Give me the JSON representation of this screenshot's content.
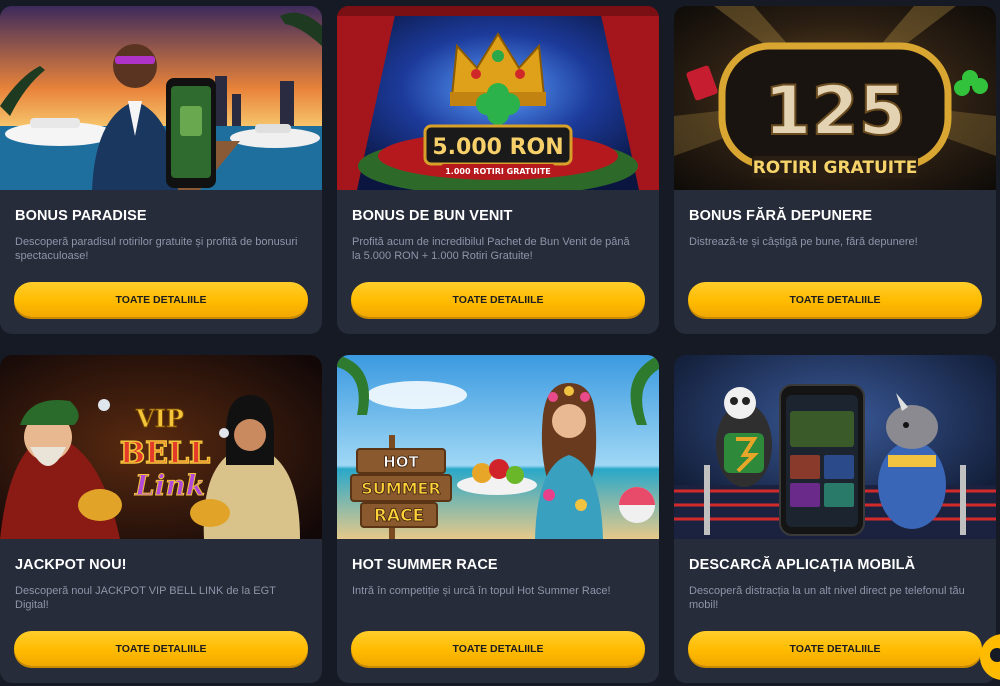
{
  "cards": [
    {
      "title": "BONUS PARADISE",
      "description": "Descoperă paradisul rotirilor gratuite și profită de bonusuri spectaculoase!",
      "button": "TOATE DETALIILE",
      "image": "man-with-phone-yachts-sunset"
    },
    {
      "title": "BONUS DE BUN VENIT",
      "description": "Profită acum de incredibilul Pachet de Bun Venit de până la 5.000 RON + 1.000 Rotiri Gratuite!",
      "button": "TOATE DETALIILE",
      "image": "crown-on-stage",
      "banner_text": [
        "5.000 RON",
        "1.000 ROTIRI GRATUITE"
      ]
    },
    {
      "title": "BONUS FĂRĂ DEPUNERE",
      "description": "Distrează-te și câștigă pe bune, fără depunere!",
      "button": "TOATE DETALIILE",
      "image": "125-golden-badge",
      "banner_text": [
        "125",
        "ROTIRI GRATUITE"
      ]
    },
    {
      "title": "JACKPOT NOU!",
      "description": "Descoperă noul JACKPOT VIP BELL LINK de la EGT Digital!",
      "button": "TOATE DETALIILE",
      "image": "vip-bell-link-characters",
      "banner_text": [
        "VIP",
        "BELL",
        "Link"
      ]
    },
    {
      "title": "HOT SUMMER RACE",
      "description": "Intră în competiție și urcă în topul Hot Summer Race!",
      "button": "TOATE DETALIILE",
      "image": "beach-woman-fruit-platter",
      "banner_text": [
        "HOT",
        "SUMMER",
        "RACE"
      ]
    },
    {
      "title": "DESCARCĂ APLICAȚIA MOBILĂ",
      "description": "Descoperă distracția la un alt nivel direct pe telefonul tău mobil!",
      "button": "TOATE DETALIILE",
      "image": "panda-rhino-boxing-ring-phone"
    }
  ],
  "colors": {
    "page_bg": "#161a24",
    "card_bg": "#262c3a",
    "button": "#ffbb00",
    "title": "#ffffff",
    "description": "#8d95a8"
  },
  "chat_widget": {
    "icon": "chat-bubble-icon"
  }
}
